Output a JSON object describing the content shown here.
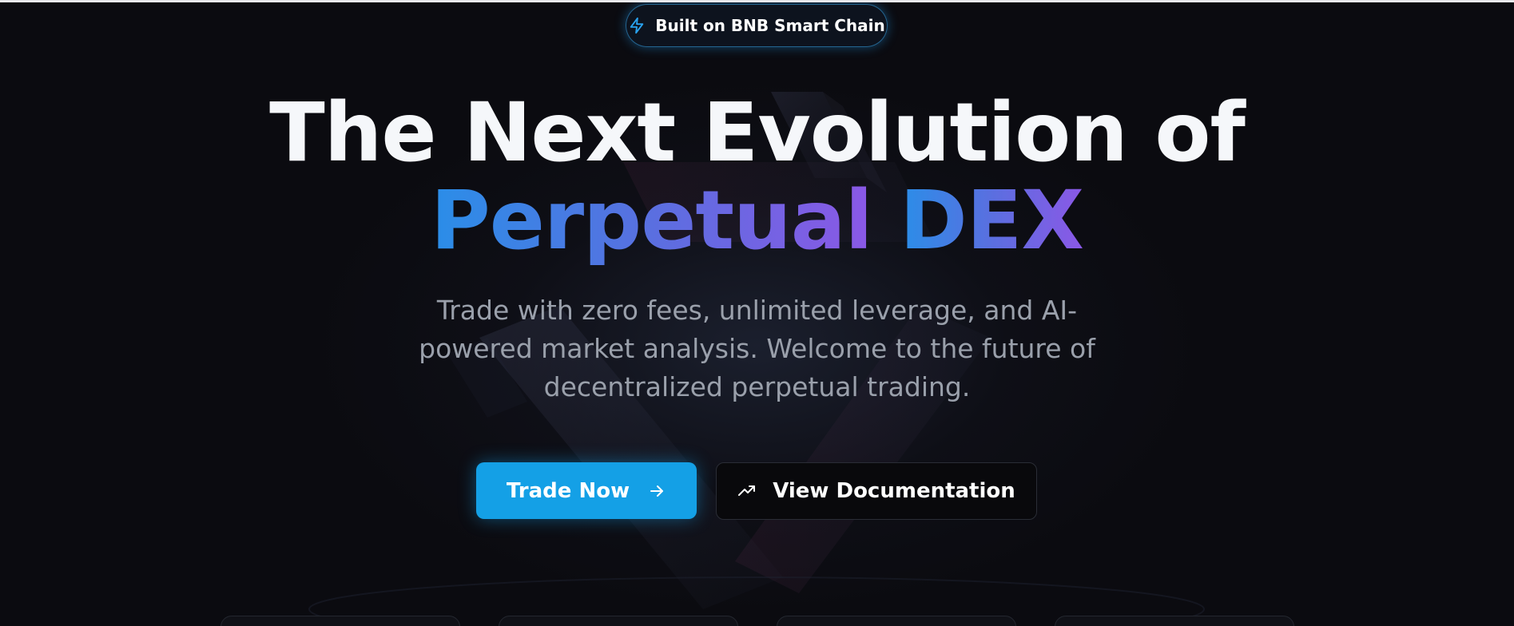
{
  "hero": {
    "badge": {
      "icon": "lightning-icon",
      "label": "Built on BNB Smart Chain"
    },
    "headline_line1": "The Next Evolution of",
    "headline_line2_part1": "Perpetual",
    "headline_line2_part2": "DEX",
    "subtitle": "Trade with zero fees, unlimited leverage, and AI-powered market analysis. Welcome to the future of decentralized perpetual trading.",
    "primary_button": {
      "label": "Trade Now",
      "icon": "arrow-right-icon"
    },
    "secondary_button": {
      "label": "View Documentation",
      "icon": "trending-up-icon"
    }
  },
  "colors": {
    "background": "#0b0b10",
    "accent": "#14a0e6",
    "gradient_start": "#2a8ee8",
    "gradient_end": "#8b58e6"
  },
  "feature_cards": [
    {},
    {},
    {},
    {}
  ]
}
